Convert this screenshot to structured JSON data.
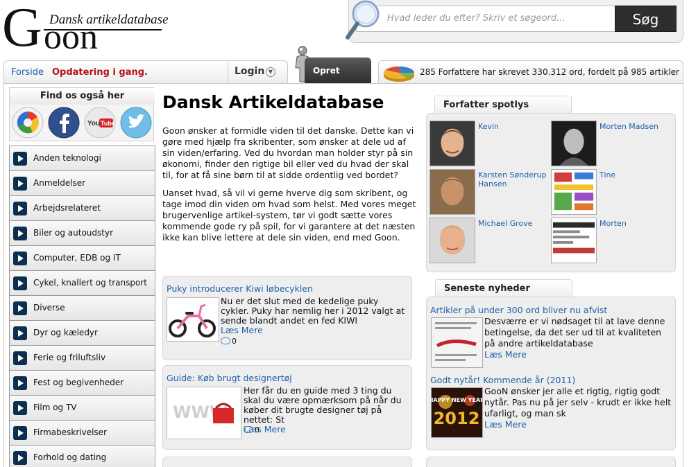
{
  "logo": {
    "letter": "G",
    "rest": "oon",
    "tagline": "Dansk artikeldatabase"
  },
  "search": {
    "placeholder": "Hvad leder du efter? Skriv et søgeord...",
    "button_label": "Søg"
  },
  "nav": {
    "home": "Forside",
    "status": "Opdatering i gang.",
    "login": "Login",
    "create_user": "Opret bruger",
    "stats": "285 Forfattere har skrevet 330.312 ord, fordelt på 985 artikler"
  },
  "sidebar": {
    "find_title": "Find os også her",
    "social": [
      "google-icon",
      "facebook-icon",
      "youtube-icon",
      "twitter-icon"
    ],
    "categories": [
      "Anden teknologi",
      "Anmeldelser",
      "Arbejdsrelateret",
      "Biler og autoudstyr",
      "Computer, EDB og IT",
      "Cykel, knallert og transport",
      "Diverse",
      "Dyr og kæledyr",
      "Ferie og friluftsliv",
      "Fest og begivenheder",
      "Film og TV",
      "Firmabeskrivelser",
      "Forhold og dating"
    ]
  },
  "main": {
    "title": "Dansk Artikeldatabase",
    "intro": [
      "Goon ønsker at formidle viden til det danske. Dette kan vi gøre med hjælp fra skribenter, som ønsker at dele ud af sin viden/erfaring. Ved du hvordan man holder styr på sin økonomi, finder den rigtige bil eller ved du hvad der skal til, for at få sine børn til at sidde ordentlig ved bordet?",
      "Uanset hvad, så vil vi gerne hverve dig som skribent, og tage imod din viden om hvad som helst. Med vores meget brugervenlige artikel-system, tør vi godt sætte vores kommende gode ry på spil, for vi garantere at det næsten ikke kan blive lettere at dele sin viden, end med Goon."
    ],
    "articles": [
      {
        "title": "Puky introducerer Kiwi løbecyklen",
        "text": "Nu er det slut med de kedelige puky cykler. Puky har nemlig her i 2012 valgt at sende blandt andet en fed KIWI",
        "read_more": "Læs Mere",
        "comments": "0"
      },
      {
        "title": "Guide: Køb brugt designertøj",
        "text": "Her får du en guide med 3 ting du skal du være opmærksom på når du køber dit brugte designer tøj på nettet: St",
        "read_more": "Læs Mere",
        "comments": "0"
      }
    ]
  },
  "spotlight": {
    "title": "Forfatter spotlys",
    "authors": [
      {
        "name": "Kevin"
      },
      {
        "name": "Morten Madsen"
      },
      {
        "name": "Karsten Sønderup Hansen"
      },
      {
        "name": "Tine"
      },
      {
        "name": "Michael Grove"
      },
      {
        "name": "Morten"
      }
    ]
  },
  "news": {
    "title": "Seneste nyheder",
    "items": [
      {
        "title": "Artikler på under 300 ord bliver nu afvist",
        "text": "Desværre er vi nødsaget til at lave denne betingelse, da det ser ud til at kvaliteten på andre artikeldatabase",
        "read_more": "Læs Mere"
      },
      {
        "title": "Godt nytår! Kommende år (2011)",
        "text": "GooN ønsker jer alle et rigtig, rigtig godt nytår. Pas nu på jer selv - krudt er ikke helt ufarligt, og man sk",
        "read_more": "Læs Mere",
        "image_text_top": "HAPPY NEW YEAR",
        "image_text_year": "2012"
      }
    ]
  },
  "colors": {
    "link": "#1e5fa8",
    "status_red": "#b3111a",
    "category_arrow": "#0d2f4f",
    "search_button": "#2e2e2e"
  }
}
